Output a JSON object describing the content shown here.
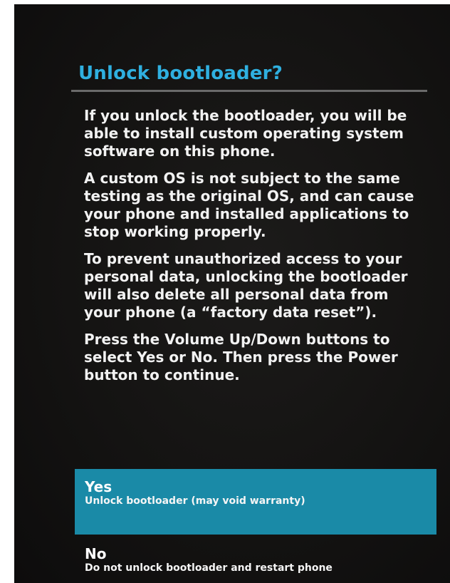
{
  "dialog": {
    "title": "Unlock bootloader?",
    "paragraphs": [
      "If you unlock the bootloader, you will be able to install custom operating system software on this phone.",
      "A custom OS is not subject to the same testing as the original OS, and can cause your phone and installed applications to stop working properly.",
      "To prevent unauthorized access to your personal data, unlocking the bootloader will also delete all personal data from your phone (a “factory data reset”).",
      "Press the Volume Up/Down buttons to select Yes or No. Then press the Power button to continue."
    ]
  },
  "options": [
    {
      "label": "Yes",
      "description": "Unlock bootloader (may void warranty)",
      "selected": true
    },
    {
      "label": "No",
      "description": "Do not unlock bootloader and restart phone",
      "selected": false
    }
  ],
  "colors": {
    "accent": "#2fb0e0",
    "selection": "#1a8aa7",
    "background": "#141312"
  }
}
